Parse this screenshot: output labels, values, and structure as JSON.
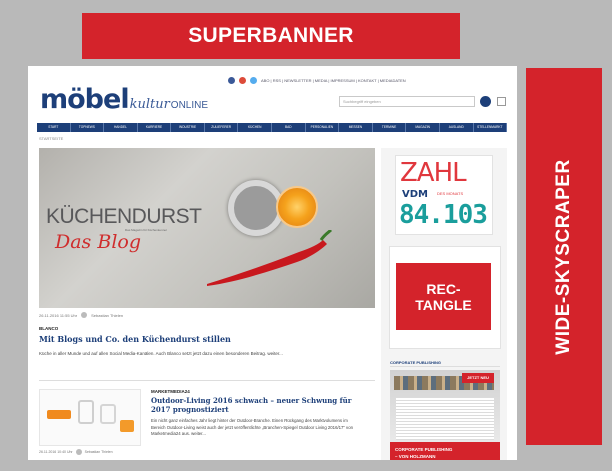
{
  "placeholders": {
    "superbanner": "SUPERBANNER",
    "wide_skyscraper": "WIDE-SKYSCRAPER",
    "rectangle": "REC-\nTANGLE"
  },
  "colors": {
    "ad_red": "#d4232b",
    "brand_blue": "#1d3f79",
    "teal": "#1a9e9c"
  },
  "site": {
    "logo": {
      "main": "möbel",
      "kultur": "kultur",
      "online": "ONLINE"
    },
    "top_links": "ABO | RSS | NEWSLETTER | MEDIA | IMPRESSUM | KONTAKT | MEDIADATEN",
    "search_placeholder": "Suchbegriff eingeben",
    "nav": [
      "START",
      "TOPNEWS",
      "HANDEL",
      "KARRIERE",
      "INDUSTRIE",
      "ZULIEFERER",
      "KÜCHEN",
      "BAD",
      "PERSONALIEN",
      "MESSEN",
      "TERMINE",
      "MAGAZIN",
      "AUSLAND",
      "STELLENMARKT"
    ],
    "breadcrumb": "STARTSEITE",
    "hero": {
      "title": "KÜCHENDURST",
      "subtitle": "Das Magazin für Küchenkenner",
      "blog": "Das Blog"
    },
    "article1": {
      "meta": "26.11.2016 11:55 Uhr",
      "author": "Sebastian Thielen",
      "category": "BLANCO",
      "title": "Mit Blogs und Co. den Küchendurst stillen",
      "teaser": "Küche in aller Munde und auf allen Social Media-Kanälen. Auch Blanco setzt jetzt dazu einen besonderen Beitrag. weiter..."
    },
    "article2": {
      "meta": "26.11.2016 10:40 Uhr",
      "author": "Sebastian Thielen",
      "category": "MARKETMEDIA24",
      "title": "Outdoor-Living 2016 schwach – neuer Schwung für 2017 prognostiziert",
      "teaser": "Ein nicht ganz einfaches Jahr liegt hinter der Outdoor-Branche. Einen Rückgang des Marktvolumens im Bereich Outdoor-Living weist auch der jetzt veröffentlichte „Branchen-Spiegel Outdoor Living 2016/17“ von Marketmedia24 aus. weiter..."
    },
    "sidebar": {
      "zahl": {
        "word": "ZAHL",
        "vdm": "VDM",
        "monat": "DES MONATS",
        "number": "84.103"
      },
      "corporate_label": "CORPORATE PUBLISHING",
      "jetzt_neu": "JETZT NEU",
      "cp_banner": "CORPORATE PUBLISHING\n– VON HOLZMANN"
    }
  }
}
